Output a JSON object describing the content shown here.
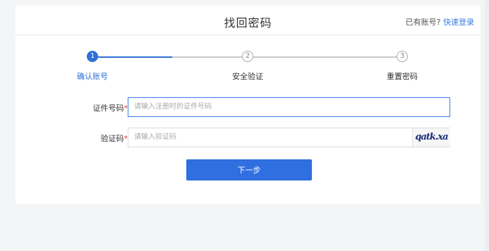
{
  "header": {
    "title": "找回密码",
    "login_prompt": "已有账号?",
    "login_link": "快速登录"
  },
  "steps": [
    {
      "number": "1",
      "label": "确认账号",
      "state": "active"
    },
    {
      "number": "2",
      "label": "安全验证",
      "state": "inactive"
    },
    {
      "number": "3",
      "label": "重置密码",
      "state": "inactive"
    }
  ],
  "form": {
    "id_label": "证件号码",
    "id_placeholder": "请输入注册时的证件号码",
    "captcha_label": "验证码",
    "captcha_placeholder": "请输入验证码",
    "captcha_text": "qatk.xa",
    "required_mark": "*",
    "next_label": "下一步"
  },
  "colors": {
    "accent": "#2f6fd6",
    "required": "#e0353b"
  }
}
